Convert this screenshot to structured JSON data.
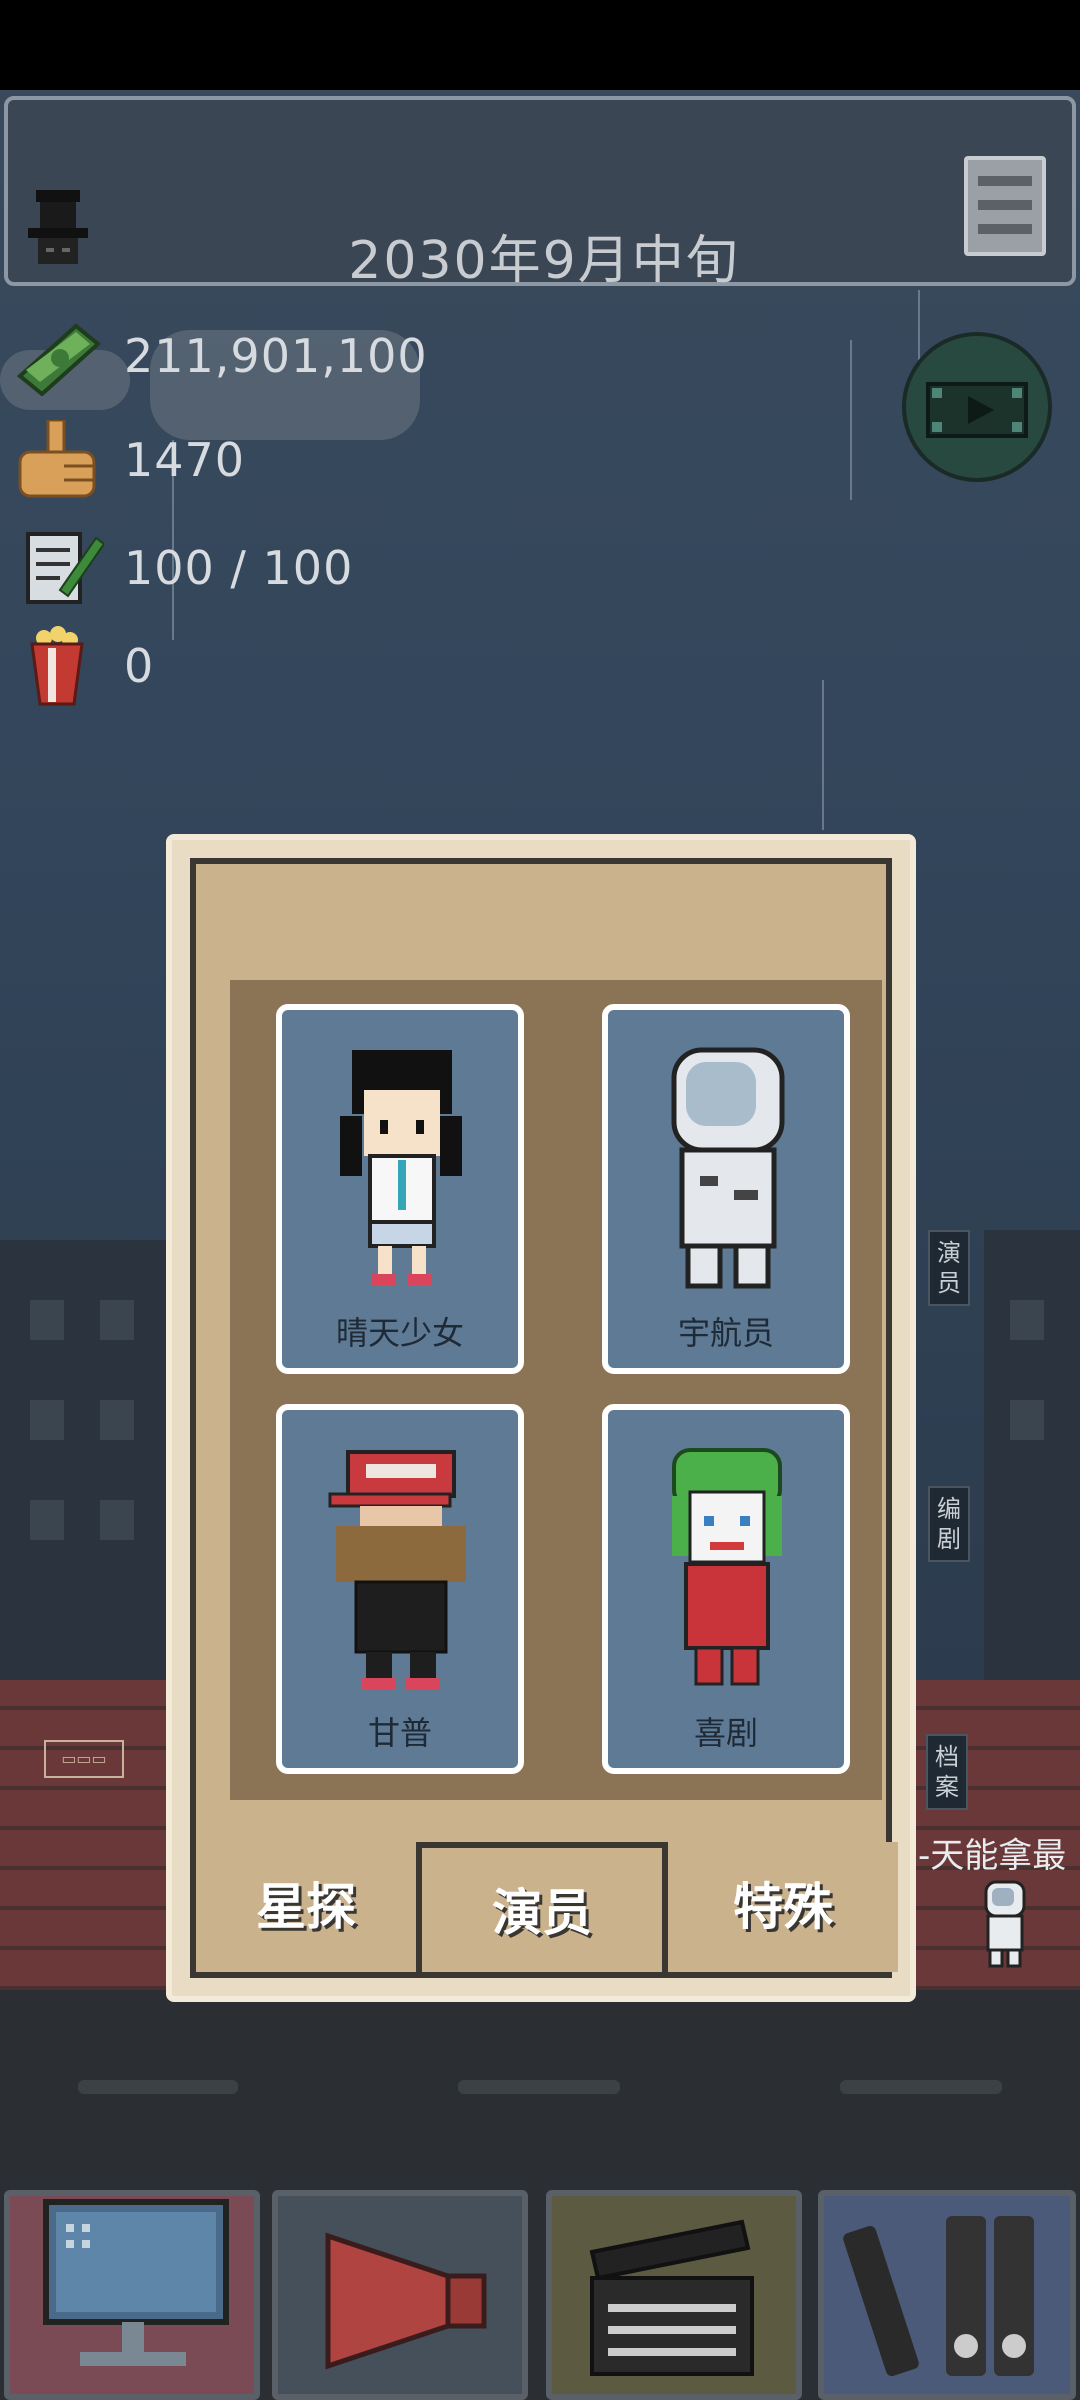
{
  "header": {
    "date": "2030年9月中旬"
  },
  "stats": {
    "money": "211,901,100",
    "likes": "1470",
    "scripts": "100 / 100",
    "popcorn": "0"
  },
  "side_tags": {
    "actors": "演员",
    "writers": "编剧",
    "archive": "档案"
  },
  "ticker": "-天能拿最",
  "dialog": {
    "cards": [
      {
        "name": "晴天少女"
      },
      {
        "name": "宇航员"
      },
      {
        "name": "甘普"
      },
      {
        "name": "喜剧"
      }
    ],
    "tabs": [
      "星探",
      "演员",
      "特殊"
    ]
  },
  "colors": {
    "sky": "#33465b",
    "card_bg": "#5f7a95",
    "dialog_bg": "#c9b28c",
    "grid_bg": "#8b7456"
  },
  "icons": [
    "hat-icon",
    "menu-icon",
    "money-icon",
    "thumbs-up-icon",
    "script-icon",
    "popcorn-icon",
    "video-icon",
    "computer-icon",
    "megaphone-icon",
    "clapperboard-icon",
    "film-reel-icon"
  ]
}
